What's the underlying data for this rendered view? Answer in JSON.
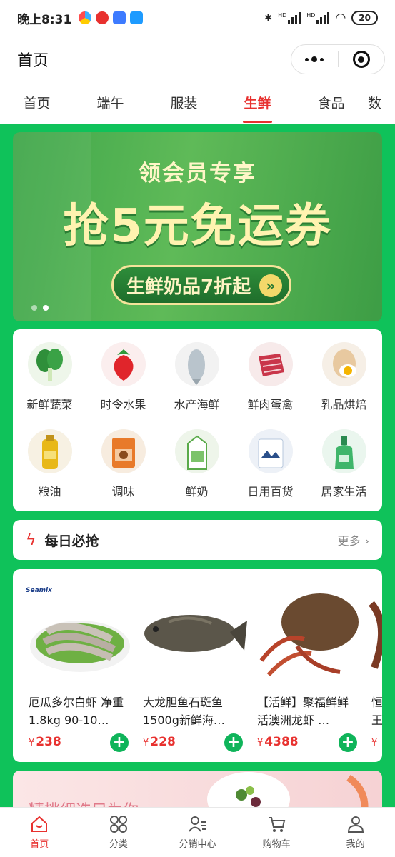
{
  "status_bar": {
    "time": "晚上8:31",
    "battery": "20",
    "hd1": "HD",
    "hd2": "HD"
  },
  "nav": {
    "title": "首页"
  },
  "tabs": [
    {
      "label": "首页"
    },
    {
      "label": "端午"
    },
    {
      "label": "服装"
    },
    {
      "label": "生鲜"
    },
    {
      "label": "食品"
    },
    {
      "label": "数"
    }
  ],
  "banner": {
    "subtitle": "领会员专享",
    "headline": "抢5元免运券",
    "pill": "生鲜奶品7折起"
  },
  "categories": [
    {
      "label": "新鲜蔬菜",
      "icon": "vegetable-icon"
    },
    {
      "label": "时令水果",
      "icon": "strawberry-icon"
    },
    {
      "label": "水产海鲜",
      "icon": "fish-icon"
    },
    {
      "label": "鲜肉蛋禽",
      "icon": "meat-icon"
    },
    {
      "label": "乳品烘焙",
      "icon": "egg-icon"
    },
    {
      "label": "粮油",
      "icon": "oil-icon"
    },
    {
      "label": "调味",
      "icon": "seasoning-icon"
    },
    {
      "label": "鲜奶",
      "icon": "milk-icon"
    },
    {
      "label": "日用百货",
      "icon": "daily-goods-icon"
    },
    {
      "label": "居家生活",
      "icon": "home-care-icon"
    }
  ],
  "deals": {
    "title": "每日必抢",
    "more": "更多"
  },
  "products": [
    {
      "name": "厄瓜多尔白虾 净重1.8kg 90-10…",
      "price": "238",
      "brand": "Seamix"
    },
    {
      "name": "大龙胆鱼石斑鱼1500g新鲜海…",
      "price": "228"
    },
    {
      "name": "【活鲜】聚福鲜鲜活澳洲龙虾 …",
      "price": "4388"
    },
    {
      "name": "恒王",
      "price": ""
    }
  ],
  "currency": "¥",
  "promo": {
    "text": "精挑细选只为你"
  },
  "tabbar": [
    {
      "label": "首页",
      "icon": "home-icon"
    },
    {
      "label": "分类",
      "icon": "category-icon"
    },
    {
      "label": "分销中心",
      "icon": "distribution-icon"
    },
    {
      "label": "购物车",
      "icon": "cart-icon"
    },
    {
      "label": "我的",
      "icon": "profile-icon"
    }
  ],
  "colors": {
    "accent": "#e8312f",
    "green": "#0fc25a"
  }
}
